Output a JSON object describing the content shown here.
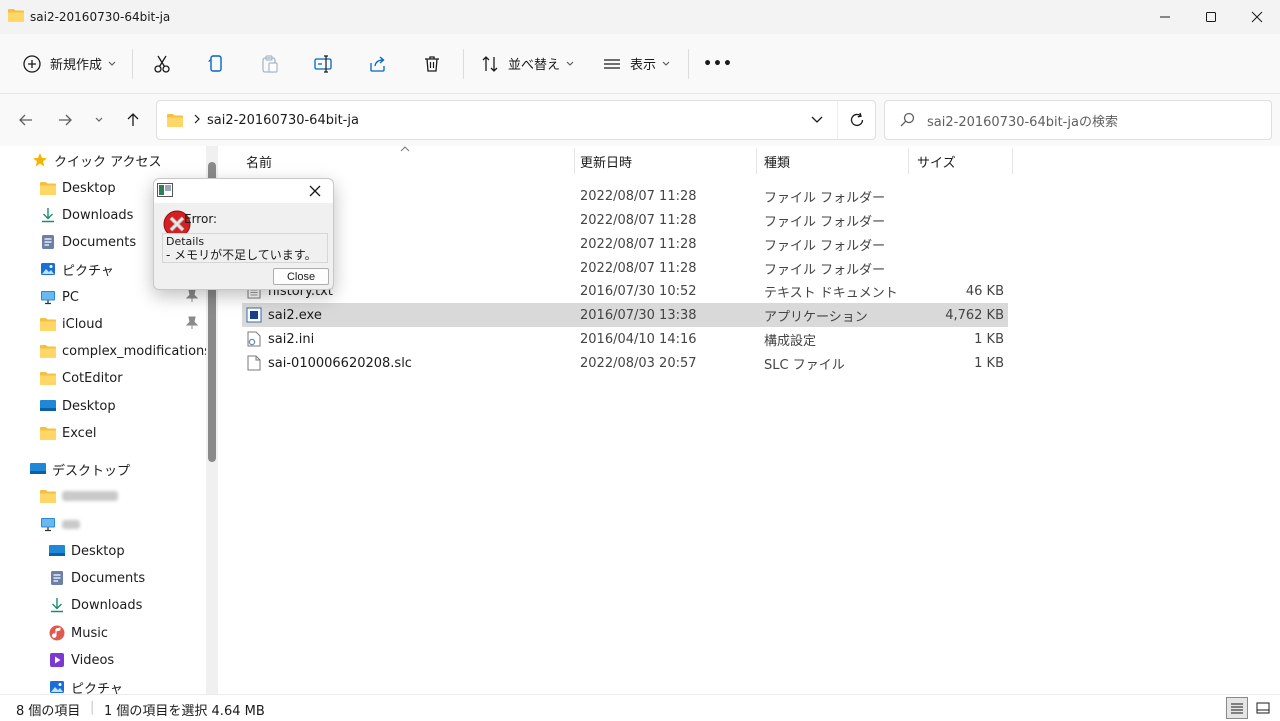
{
  "window": {
    "title": "sai2-20160730-64bit-ja"
  },
  "toolbar": {
    "new_label": "新規作成",
    "sort_label": "並べ替え",
    "view_label": "表示",
    "more_label": "•••"
  },
  "address": {
    "crumb": "sai2-20160730-64bit-ja",
    "search_placeholder": "sai2-20160730-64bit-jaの検索"
  },
  "sidebar": {
    "quick_access": "クイック アクセス",
    "quick_items": [
      {
        "label": "Desktop"
      },
      {
        "label": "Downloads"
      },
      {
        "label": "Documents"
      },
      {
        "label": "ピクチャ"
      },
      {
        "label": "PC"
      },
      {
        "label": "iCloud"
      },
      {
        "label": "complex_modifications"
      },
      {
        "label": "CotEditor"
      },
      {
        "label": "Desktop"
      },
      {
        "label": "Excel"
      }
    ],
    "desktop_root": "デスクトップ",
    "pc_items": [
      {
        "label": "Desktop"
      },
      {
        "label": "Documents"
      },
      {
        "label": "Downloads"
      },
      {
        "label": "Music"
      },
      {
        "label": "Videos"
      },
      {
        "label": "ピクチャ"
      }
    ]
  },
  "columns": {
    "name": "名前",
    "modified": "更新日時",
    "type": "種類",
    "size": "サイズ"
  },
  "files": [
    {
      "name": "",
      "modified": "2022/08/07 11:28",
      "type": "ファイル フォルダー",
      "size": ""
    },
    {
      "name": "",
      "modified": "2022/08/07 11:28",
      "type": "ファイル フォルダー",
      "size": ""
    },
    {
      "name": "",
      "modified": "2022/08/07 11:28",
      "type": "ファイル フォルダー",
      "size": ""
    },
    {
      "name": "",
      "modified": "2022/08/07 11:28",
      "type": "ファイル フォルダー",
      "size": ""
    },
    {
      "name": "history.txt",
      "modified": "2016/07/30 10:52",
      "type": "テキスト ドキュメント",
      "size": "46 KB"
    },
    {
      "name": "sai2.exe",
      "modified": "2016/07/30 13:38",
      "type": "アプリケーション",
      "size": "4,762 KB"
    },
    {
      "name": "sai2.ini",
      "modified": "2016/04/10 14:16",
      "type": "構成設定",
      "size": "1 KB"
    },
    {
      "name": "sai-010006620208.slc",
      "modified": "2022/08/03 20:57",
      "type": "SLC ファイル",
      "size": "1 KB"
    }
  ],
  "status": {
    "count": "8 個の項目",
    "selection": "1 個の項目を選択  4.64 MB"
  },
  "dialog": {
    "error_title": "Error:",
    "details_label": "Details",
    "details_text": "- メモリが不足しています。",
    "close_label": "Close"
  },
  "colors": {
    "accent": "#0067c0",
    "folder": "#f5c042",
    "error_red": "#d42020",
    "selection": "#d9d9d9"
  }
}
